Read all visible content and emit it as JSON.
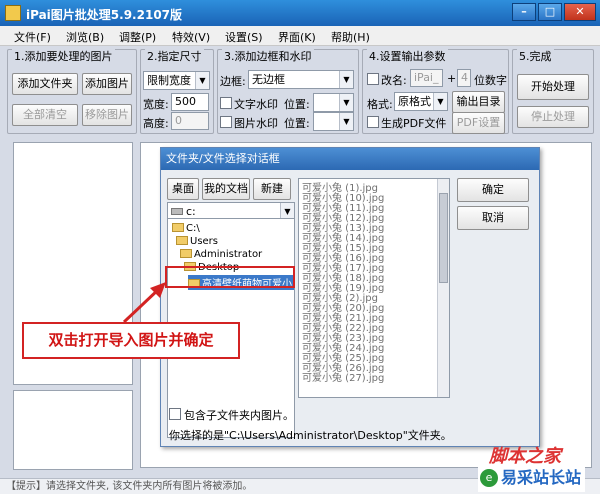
{
  "window": {
    "title": "iPai图片批处理5.9.2107版"
  },
  "menu": [
    "文件(F)",
    "浏览(B)",
    "调整(P)",
    "特效(V)",
    "设置(S)",
    "界面(K)",
    "帮助(H)"
  ],
  "group1": {
    "title": "1.添加要处理的图片",
    "add_folder": "添加文件夹",
    "add_image": "添加图片",
    "clear_all": "全部清空",
    "remove_image": "移除图片"
  },
  "group2": {
    "title": "2.指定尺寸",
    "mode": "限制宽度",
    "width_label": "宽度:",
    "width_value": "500",
    "height_label": "高度:",
    "height_value": "0"
  },
  "group3": {
    "title": "3.添加边框和水印",
    "border_label": "边框:",
    "border_value": "无边框",
    "text_wm": "文字水印",
    "image_wm": "图片水印",
    "position_label": "位置:"
  },
  "group4": {
    "title": "4.设置输出参数",
    "rename": "改名:",
    "rename_value": "iPai_",
    "plus": "+",
    "digits": "4",
    "digits_label": "位数字",
    "format_label": "格式:",
    "format_value": "原格式",
    "output_dir": "输出目录",
    "pdf": "生成PDF文件",
    "pdf_settings": "PDF设置"
  },
  "group5": {
    "title": "5.完成",
    "start": "开始处理",
    "stop": "停止处理"
  },
  "dialog": {
    "title": "文件夹/文件选择对话框",
    "desktop": "桌面",
    "documents": "我的文档",
    "new": "新建",
    "ok": "确定",
    "cancel": "取消",
    "drive": "c:",
    "tree": [
      "C:\\",
      "Users",
      "Administrator",
      "Desktop",
      "高清壁纸萌物可爱小"
    ],
    "files": [
      "可爱小兔 (1).jpg",
      "可爱小兔 (10).jpg",
      "可爱小兔 (11).jpg",
      "可爱小兔 (12).jpg",
      "可爱小兔 (13).jpg",
      "可爱小兔 (14).jpg",
      "可爱小兔 (15).jpg",
      "可爱小兔 (16).jpg",
      "可爱小兔 (17).jpg",
      "可爱小兔 (18).jpg",
      "可爱小兔 (19).jpg",
      "可爱小兔 (2).jpg",
      "可爱小兔 (20).jpg",
      "可爱小兔 (21).jpg",
      "可爱小兔 (22).jpg",
      "可爱小兔 (23).jpg",
      "可爱小兔 (24).jpg",
      "可爱小兔 (25).jpg",
      "可爱小兔 (26).jpg",
      "可爱小兔 (27).jpg"
    ],
    "include_sub": "包含子文件夹内图片。",
    "selected": "你选择的是\"C:\\Users\\Administrator\\Desktop\"文件夹。"
  },
  "callout": "双击打开导入图片并确定",
  "status": "【提示】请选择文件夹, 该文件夹内所有图片将被添加。",
  "watermark": {
    "line1": "脚本之家",
    "site": "易采站长站"
  }
}
